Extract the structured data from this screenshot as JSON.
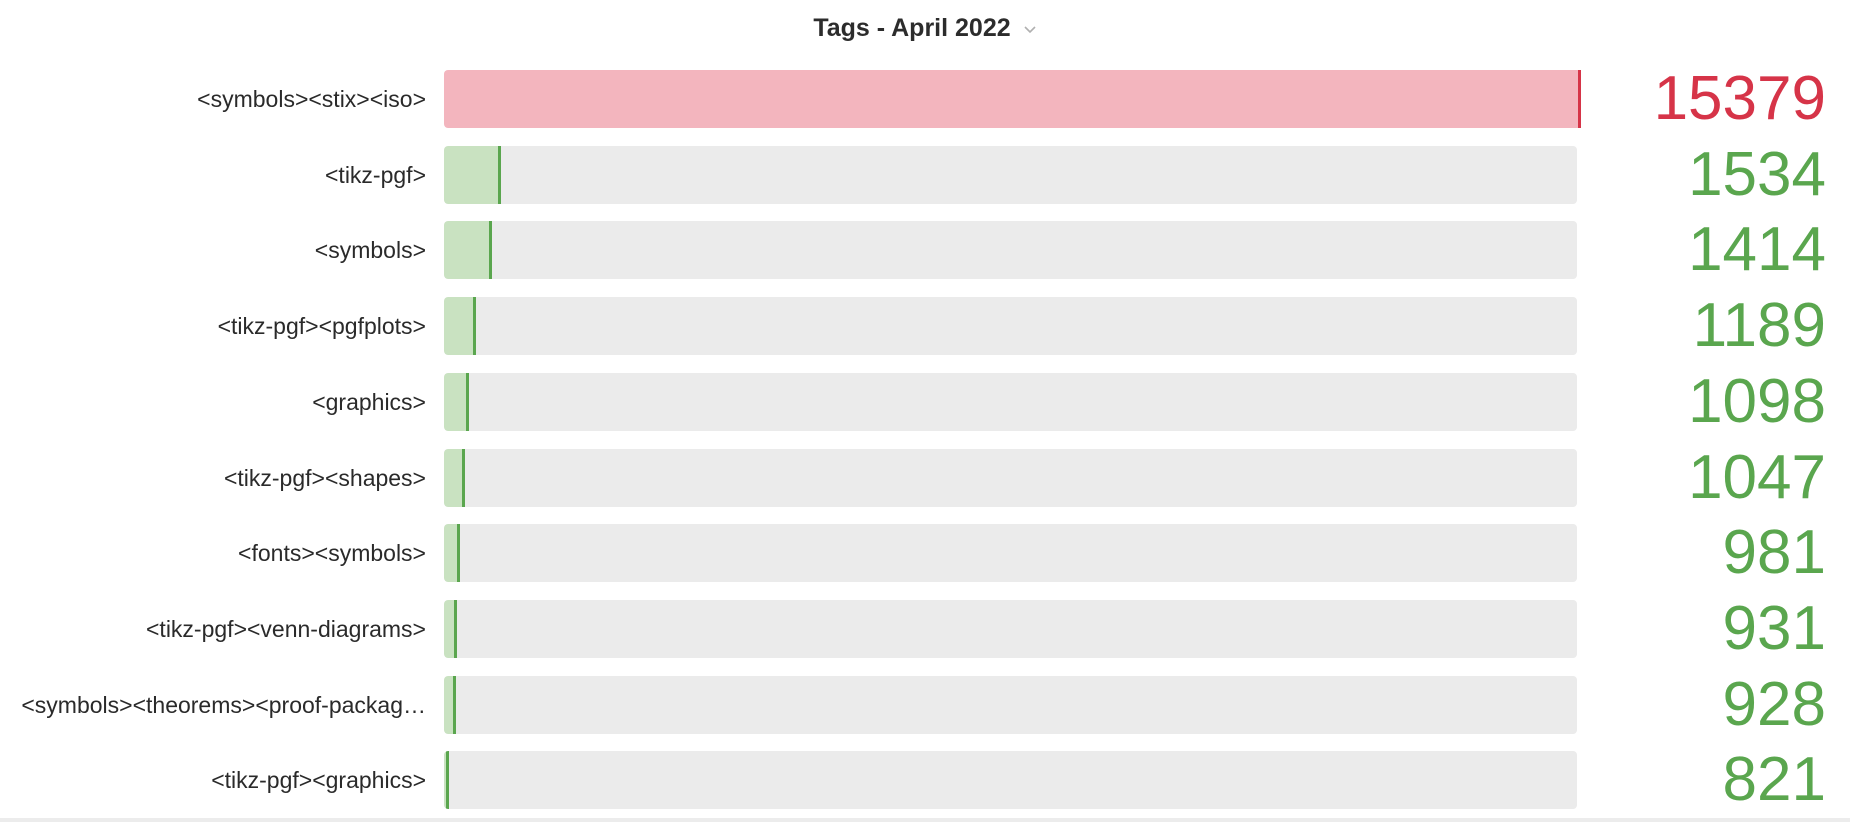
{
  "header": {
    "title": "Tags - April 2022",
    "dropdown_icon": "chevron-down-icon"
  },
  "colors": {
    "top": "#d63448",
    "top_fill": "#f3b5be",
    "rest": "#5aa64e",
    "rest_fill": "#c9e2c1",
    "track": "#ebebeb"
  },
  "chart_data": {
    "type": "bar",
    "title": "Tags - April 2022",
    "orientation": "horizontal",
    "categories": [
      "<symbols><stix><iso>",
      "<tikz-pgf>",
      "<symbols>",
      "<tikz-pgf><pgfplots>",
      "<graphics>",
      "<tikz-pgf><shapes>",
      "<fonts><symbols>",
      "<tikz-pgf><venn-diagrams>",
      "<symbols><theorems><proof-packag…",
      "<tikz-pgf><graphics>"
    ],
    "values": [
      15379,
      1534,
      1414,
      1189,
      1098,
      1047,
      981,
      931,
      928,
      821
    ],
    "display_values": [
      "15379",
      "1534",
      "1414",
      "1189",
      "1098",
      "1047",
      "981",
      "931",
      "928",
      "821"
    ],
    "xlim": [
      0,
      15379
    ],
    "grid": false,
    "legend": "none"
  }
}
